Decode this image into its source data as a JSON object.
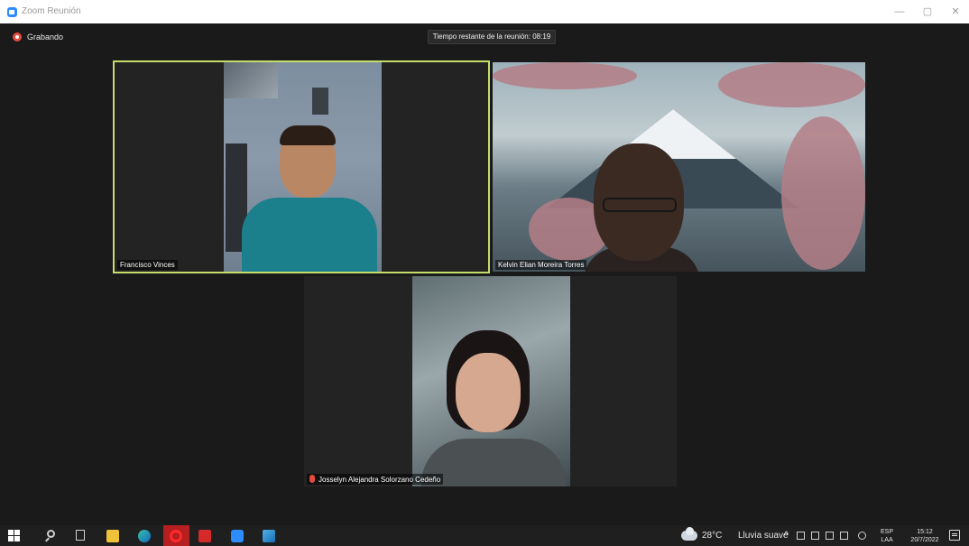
{
  "window": {
    "title": "Zoom Reunión",
    "minimize": "—",
    "maximize": "▢",
    "close": "✕"
  },
  "meeting": {
    "recording_label": "Grabando",
    "time_remaining": "Tiempo restante de la reunión: 08:19",
    "active_speaker_color": "#c7dd6a",
    "participants": [
      {
        "name": "Francisco Vinces"
      },
      {
        "name": "Kelvin Elian Moreira Torres"
      },
      {
        "name": "Josselyn Alejandra Solorzano Cedeño",
        "muted": true
      }
    ]
  },
  "taskbar": {
    "apps": [
      "windows-start",
      "search",
      "task-view",
      "file-explorer",
      "edge",
      "opera",
      "acrobat",
      "zoom",
      "photos"
    ],
    "weather_temp": "28°C",
    "weather_desc": "Lluvia suave",
    "chevron": "^",
    "language": "ESP",
    "language_sub": "LAA",
    "time": "15:12",
    "date": "20/7/2022"
  }
}
